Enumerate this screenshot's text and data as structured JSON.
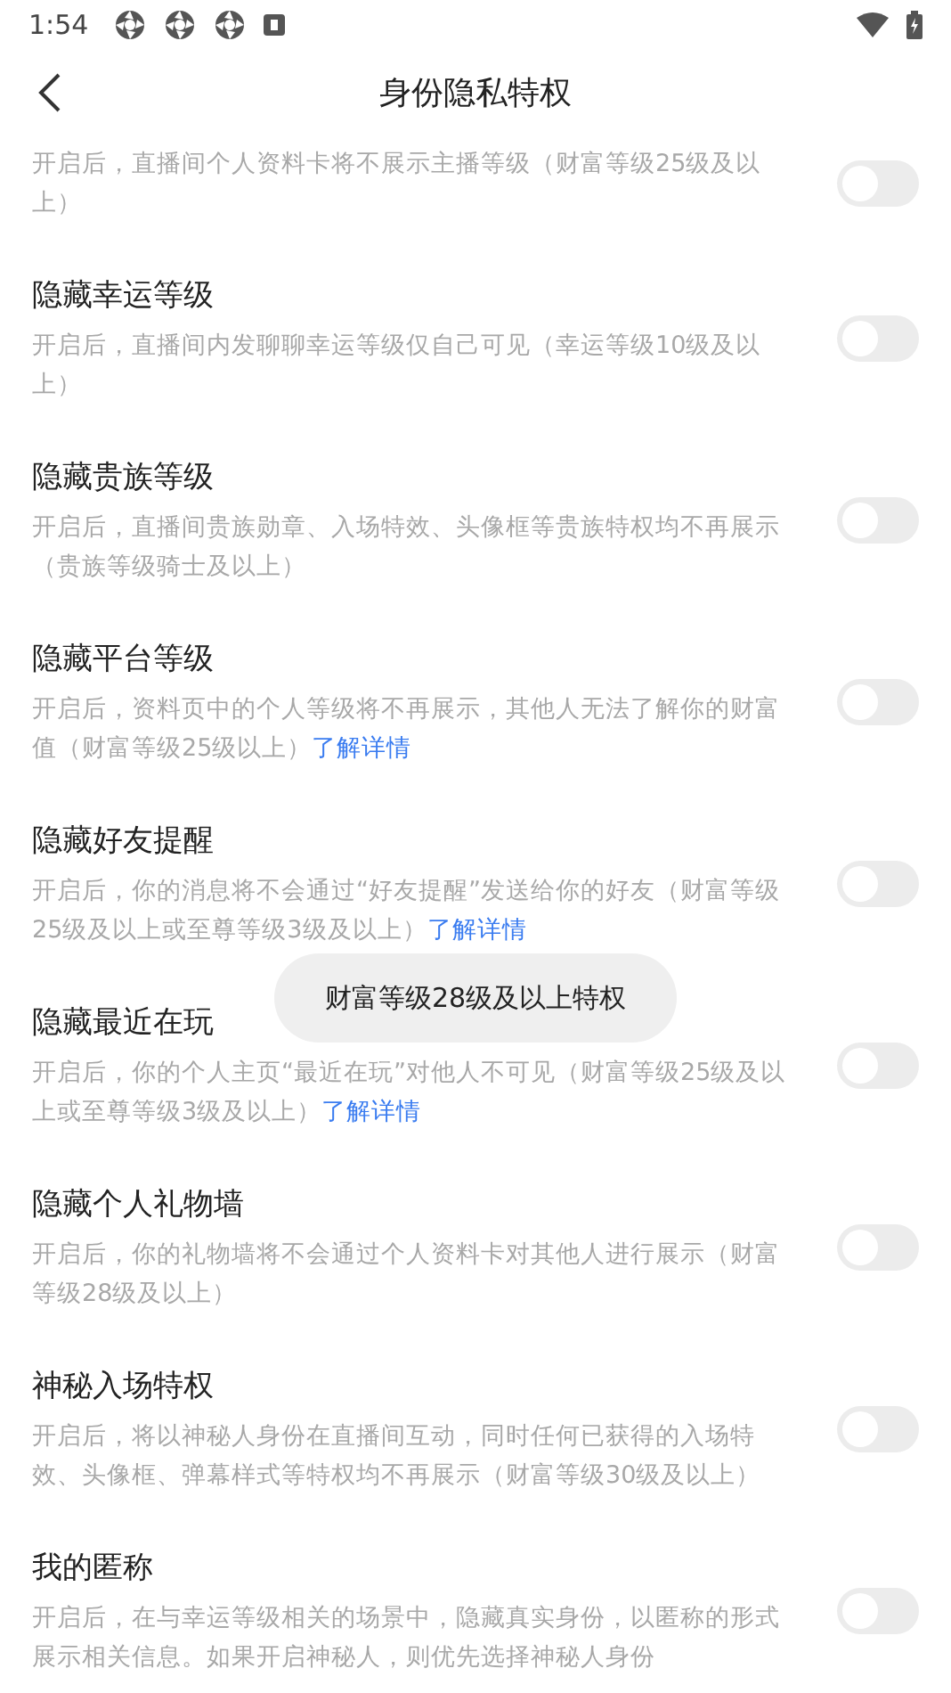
{
  "status_bar": {
    "time": "1:54"
  },
  "header": {
    "title": "身份隐私特权"
  },
  "items": [
    {
      "desc": "开启后，直播间个人资料卡将不展示主播等级（财富等级25级及以上）",
      "on": false
    },
    {
      "title": "隐藏幸运等级",
      "desc": "开启后，直播间内发聊聊幸运等级仅自己可见（幸运等级10级及以上）",
      "on": false
    },
    {
      "title": "隐藏贵族等级",
      "desc": "开启后，直播间贵族勋章、入场特效、头像框等贵族特权均不再展示（贵族等级骑士及以上）",
      "on": false
    },
    {
      "title": "隐藏平台等级",
      "desc": "开启后，资料页中的个人等级将不再展示，其他人无法了解你的财富值（财富等级25级以上）",
      "link": "了解详情",
      "on": false
    },
    {
      "title": "隐藏好友提醒",
      "desc": "开启后，你的消息将不会通过“好友提醒”发送给你的好友（财富等级25级及以上或至尊等级3级及以上）",
      "link": "了解详情",
      "on": false
    },
    {
      "title": "隐藏最近在玩",
      "desc": "开启后，你的个人主页“最近在玩”对他人不可见（财富等级25级及以上或至尊等级3级及以上）",
      "link": "了解详情",
      "on": false
    },
    {
      "title": "隐藏个人礼物墙",
      "desc": "开启后，你的礼物墙将不会通过个人资料卡对其他人进行展示（财富等级28级及以上）",
      "on": false
    },
    {
      "title": "神秘入场特权",
      "desc": "开启后，将以神秘人身份在直播间互动，同时任何已获得的入场特效、头像框、弹幕样式等特权均不再展示（财富等级30级及以上）",
      "on": false
    },
    {
      "title": "我的匿称",
      "desc": "开启后，在与幸运等级相关的场景中，隐藏真实身份，以匿称的形式展示相关信息。如果开启神秘人，则优先选择神秘人身份",
      "on": false
    }
  ],
  "toast": "财富等级28级及以上特权"
}
